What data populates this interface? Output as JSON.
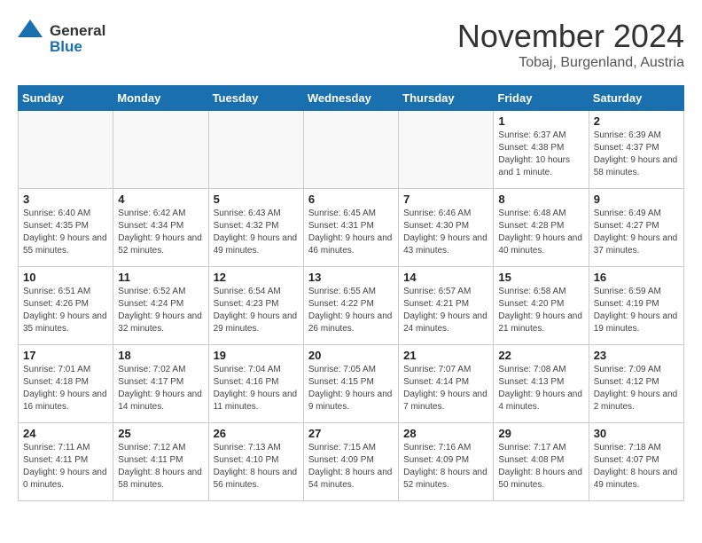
{
  "logo": {
    "line1": "General",
    "line2": "Blue"
  },
  "title": "November 2024",
  "subtitle": "Tobaj, Burgenland, Austria",
  "days_of_week": [
    "Sunday",
    "Monday",
    "Tuesday",
    "Wednesday",
    "Thursday",
    "Friday",
    "Saturday"
  ],
  "weeks": [
    [
      {
        "day": "",
        "info": ""
      },
      {
        "day": "",
        "info": ""
      },
      {
        "day": "",
        "info": ""
      },
      {
        "day": "",
        "info": ""
      },
      {
        "day": "",
        "info": ""
      },
      {
        "day": "1",
        "info": "Sunrise: 6:37 AM\nSunset: 4:38 PM\nDaylight: 10 hours and 1 minute."
      },
      {
        "day": "2",
        "info": "Sunrise: 6:39 AM\nSunset: 4:37 PM\nDaylight: 9 hours and 58 minutes."
      }
    ],
    [
      {
        "day": "3",
        "info": "Sunrise: 6:40 AM\nSunset: 4:35 PM\nDaylight: 9 hours and 55 minutes."
      },
      {
        "day": "4",
        "info": "Sunrise: 6:42 AM\nSunset: 4:34 PM\nDaylight: 9 hours and 52 minutes."
      },
      {
        "day": "5",
        "info": "Sunrise: 6:43 AM\nSunset: 4:32 PM\nDaylight: 9 hours and 49 minutes."
      },
      {
        "day": "6",
        "info": "Sunrise: 6:45 AM\nSunset: 4:31 PM\nDaylight: 9 hours and 46 minutes."
      },
      {
        "day": "7",
        "info": "Sunrise: 6:46 AM\nSunset: 4:30 PM\nDaylight: 9 hours and 43 minutes."
      },
      {
        "day": "8",
        "info": "Sunrise: 6:48 AM\nSunset: 4:28 PM\nDaylight: 9 hours and 40 minutes."
      },
      {
        "day": "9",
        "info": "Sunrise: 6:49 AM\nSunset: 4:27 PM\nDaylight: 9 hours and 37 minutes."
      }
    ],
    [
      {
        "day": "10",
        "info": "Sunrise: 6:51 AM\nSunset: 4:26 PM\nDaylight: 9 hours and 35 minutes."
      },
      {
        "day": "11",
        "info": "Sunrise: 6:52 AM\nSunset: 4:24 PM\nDaylight: 9 hours and 32 minutes."
      },
      {
        "day": "12",
        "info": "Sunrise: 6:54 AM\nSunset: 4:23 PM\nDaylight: 9 hours and 29 minutes."
      },
      {
        "day": "13",
        "info": "Sunrise: 6:55 AM\nSunset: 4:22 PM\nDaylight: 9 hours and 26 minutes."
      },
      {
        "day": "14",
        "info": "Sunrise: 6:57 AM\nSunset: 4:21 PM\nDaylight: 9 hours and 24 minutes."
      },
      {
        "day": "15",
        "info": "Sunrise: 6:58 AM\nSunset: 4:20 PM\nDaylight: 9 hours and 21 minutes."
      },
      {
        "day": "16",
        "info": "Sunrise: 6:59 AM\nSunset: 4:19 PM\nDaylight: 9 hours and 19 minutes."
      }
    ],
    [
      {
        "day": "17",
        "info": "Sunrise: 7:01 AM\nSunset: 4:18 PM\nDaylight: 9 hours and 16 minutes."
      },
      {
        "day": "18",
        "info": "Sunrise: 7:02 AM\nSunset: 4:17 PM\nDaylight: 9 hours and 14 minutes."
      },
      {
        "day": "19",
        "info": "Sunrise: 7:04 AM\nSunset: 4:16 PM\nDaylight: 9 hours and 11 minutes."
      },
      {
        "day": "20",
        "info": "Sunrise: 7:05 AM\nSunset: 4:15 PM\nDaylight: 9 hours and 9 minutes."
      },
      {
        "day": "21",
        "info": "Sunrise: 7:07 AM\nSunset: 4:14 PM\nDaylight: 9 hours and 7 minutes."
      },
      {
        "day": "22",
        "info": "Sunrise: 7:08 AM\nSunset: 4:13 PM\nDaylight: 9 hours and 4 minutes."
      },
      {
        "day": "23",
        "info": "Sunrise: 7:09 AM\nSunset: 4:12 PM\nDaylight: 9 hours and 2 minutes."
      }
    ],
    [
      {
        "day": "24",
        "info": "Sunrise: 7:11 AM\nSunset: 4:11 PM\nDaylight: 9 hours and 0 minutes."
      },
      {
        "day": "25",
        "info": "Sunrise: 7:12 AM\nSunset: 4:11 PM\nDaylight: 8 hours and 58 minutes."
      },
      {
        "day": "26",
        "info": "Sunrise: 7:13 AM\nSunset: 4:10 PM\nDaylight: 8 hours and 56 minutes."
      },
      {
        "day": "27",
        "info": "Sunrise: 7:15 AM\nSunset: 4:09 PM\nDaylight: 8 hours and 54 minutes."
      },
      {
        "day": "28",
        "info": "Sunrise: 7:16 AM\nSunset: 4:09 PM\nDaylight: 8 hours and 52 minutes."
      },
      {
        "day": "29",
        "info": "Sunrise: 7:17 AM\nSunset: 4:08 PM\nDaylight: 8 hours and 50 minutes."
      },
      {
        "day": "30",
        "info": "Sunrise: 7:18 AM\nSunset: 4:07 PM\nDaylight: 8 hours and 49 minutes."
      }
    ]
  ]
}
